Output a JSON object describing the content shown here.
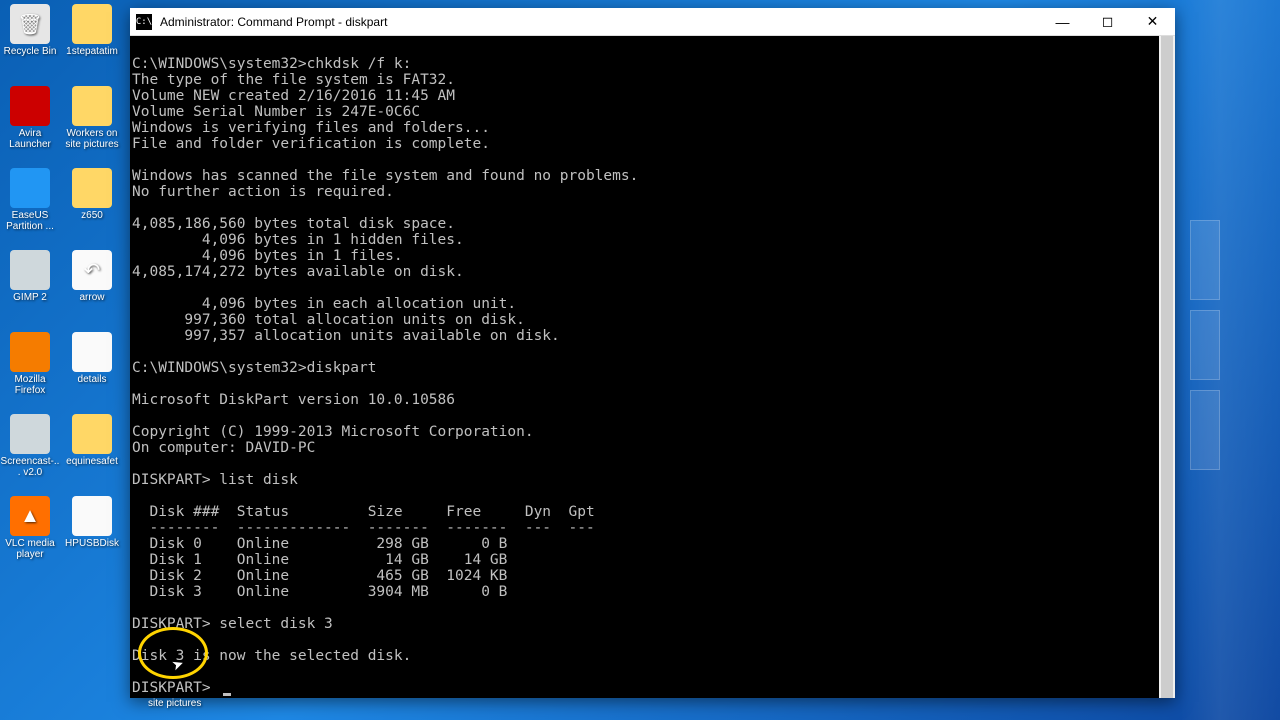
{
  "window": {
    "title": "Administrator: Command Prompt - diskpart",
    "icon_label": "C:\\"
  },
  "terminal": {
    "lines": [
      "",
      "C:\\WINDOWS\\system32>chkdsk /f k:",
      "The type of the file system is FAT32.",
      "Volume NEW created 2/16/2016 11:45 AM",
      "Volume Serial Number is 247E-0C6C",
      "Windows is verifying files and folders...",
      "File and folder verification is complete.",
      "",
      "Windows has scanned the file system and found no problems.",
      "No further action is required.",
      "",
      "4,085,186,560 bytes total disk space.",
      "        4,096 bytes in 1 hidden files.",
      "        4,096 bytes in 1 files.",
      "4,085,174,272 bytes available on disk.",
      "",
      "        4,096 bytes in each allocation unit.",
      "      997,360 total allocation units on disk.",
      "      997,357 allocation units available on disk.",
      "",
      "C:\\WINDOWS\\system32>diskpart",
      "",
      "Microsoft DiskPart version 10.0.10586",
      "",
      "Copyright (C) 1999-2013 Microsoft Corporation.",
      "On computer: DAVID-PC",
      "",
      "DISKPART> list disk",
      "",
      "  Disk ###  Status         Size     Free     Dyn  Gpt",
      "  --------  -------------  -------  -------  ---  ---",
      "  Disk 0    Online          298 GB      0 B",
      "  Disk 1    Online           14 GB    14 GB",
      "  Disk 2    Online          465 GB  1024 KB",
      "  Disk 3    Online         3904 MB      0 B",
      "",
      "DISKPART> select disk 3",
      "",
      "Disk 3 is now the selected disk.",
      "",
      "DISKPART> "
    ]
  },
  "desktop_icons": [
    {
      "label": "Recycle Bin",
      "cls": "recycle-icon",
      "glyph": "🗑"
    },
    {
      "label": "1stepatatim",
      "cls": "folder-icon",
      "glyph": ""
    },
    {
      "label": "Avira Launcher",
      "cls": "red-icon",
      "glyph": ""
    },
    {
      "label": "Workers on site pictures",
      "cls": "folder-icon",
      "glyph": ""
    },
    {
      "label": "EaseUS Partition ...",
      "cls": "blue-icon",
      "glyph": ""
    },
    {
      "label": "z650",
      "cls": "folder-icon",
      "glyph": ""
    },
    {
      "label": "GIMP 2",
      "cls": "gray-icon",
      "glyph": ""
    },
    {
      "label": "arrow",
      "cls": "white-icon",
      "glyph": "↶"
    },
    {
      "label": "Mozilla Firefox",
      "cls": "orange-icon",
      "glyph": ""
    },
    {
      "label": "details",
      "cls": "white-icon",
      "glyph": ""
    },
    {
      "label": "Screencast-... v2.0",
      "cls": "gray-icon",
      "glyph": ""
    },
    {
      "label": "equinesafet",
      "cls": "folder-icon",
      "glyph": ""
    },
    {
      "label": "VLC media player",
      "cls": "cone-icon",
      "glyph": "▲"
    },
    {
      "label": "HPUSBDisk",
      "cls": "white-icon",
      "glyph": ""
    }
  ],
  "stray_label": "site pictures"
}
